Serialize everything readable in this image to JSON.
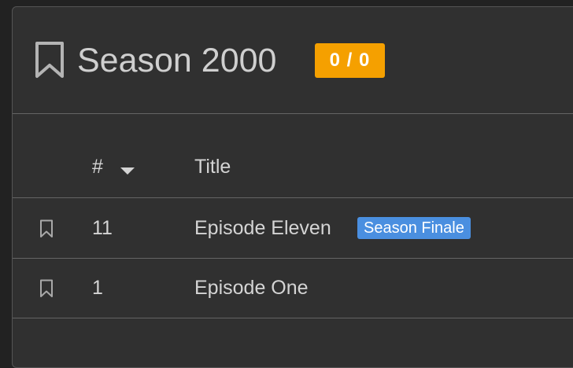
{
  "season": {
    "title": "Season 2000",
    "badge": "0 / 0",
    "badge_color": "#f5a000",
    "icon": "bookmark-outline-icon"
  },
  "table": {
    "columns": [
      {
        "label": "#",
        "sorted": "descending"
      },
      {
        "label": "Title"
      }
    ],
    "rows": [
      {
        "number": "11",
        "title": "Episode Eleven",
        "tag": "Season Finale",
        "icon": "bookmark-outline-icon"
      },
      {
        "number": "1",
        "title": "Episode One",
        "icon": "bookmark-outline-icon"
      }
    ]
  },
  "colors": {
    "tag": "#4a8fe0",
    "panel": "#303030",
    "background": "#222222"
  }
}
